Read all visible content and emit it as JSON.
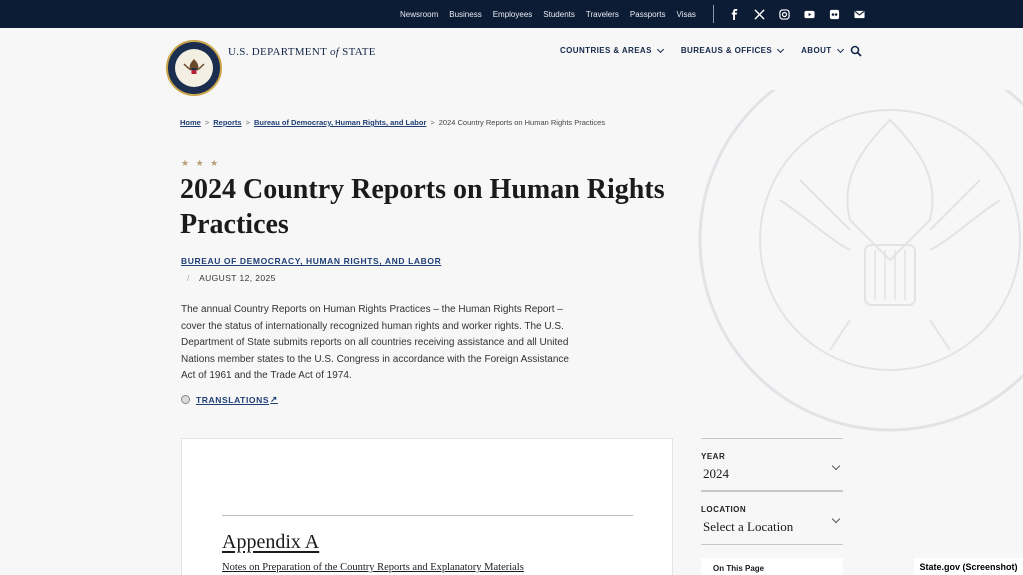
{
  "utility_nav": [
    "Newsroom",
    "Business",
    "Employees",
    "Students",
    "Travelers",
    "Passports",
    "Visas"
  ],
  "social_icons": [
    "facebook-icon",
    "x-icon",
    "instagram-icon",
    "youtube-icon",
    "flickr-icon",
    "email-icon"
  ],
  "header": {
    "brand_prefix": "U.S. DEPARTMENT",
    "brand_of": "of",
    "brand_suffix": "STATE",
    "nav": [
      "COUNTRIES & AREAS",
      "BUREAUS & OFFICES",
      "ABOUT"
    ]
  },
  "breadcrumb": {
    "home": "Home",
    "reports": "Reports",
    "bureau": "Bureau of Democracy, Human Rights, and Labor",
    "current": "2024 Country Reports on Human Rights Practices",
    "separator": ">"
  },
  "stars": "★ ★ ★",
  "page": {
    "title": "2024 Country Reports on Human Rights Practices",
    "bureau": "BUREAU OF DEMOCRACY, HUMAN RIGHTS, AND LABOR",
    "date_slash": "/",
    "date": "AUGUST 12, 2025",
    "intro": "The annual Country Reports on Human Rights Practices – the Human Rights Report – cover the status of internationally recognized human rights and worker rights. The U.S. Department of State submits reports on all countries receiving assistance and all United Nations member states to the U.S. Congress in accordance with the Foreign Assistance Act of 1961 and the Trade Act of 1974.",
    "translations": "TRANSLATIONS",
    "external_glyph": "↗"
  },
  "card": {
    "title": "Appendix A",
    "subtitle": "Notes on Preparation of the Country Reports and Explanatory Materials"
  },
  "filters": {
    "year_label": "YEAR",
    "year_value": "2024",
    "location_label": "LOCATION",
    "location_value": "Select a Location"
  },
  "on_this_page": "On This Page",
  "credit": "State.gov (Screenshot)",
  "colors": {
    "topbar": "#0c1c34",
    "link": "#1f3f75",
    "background": "#f7f7f8"
  }
}
